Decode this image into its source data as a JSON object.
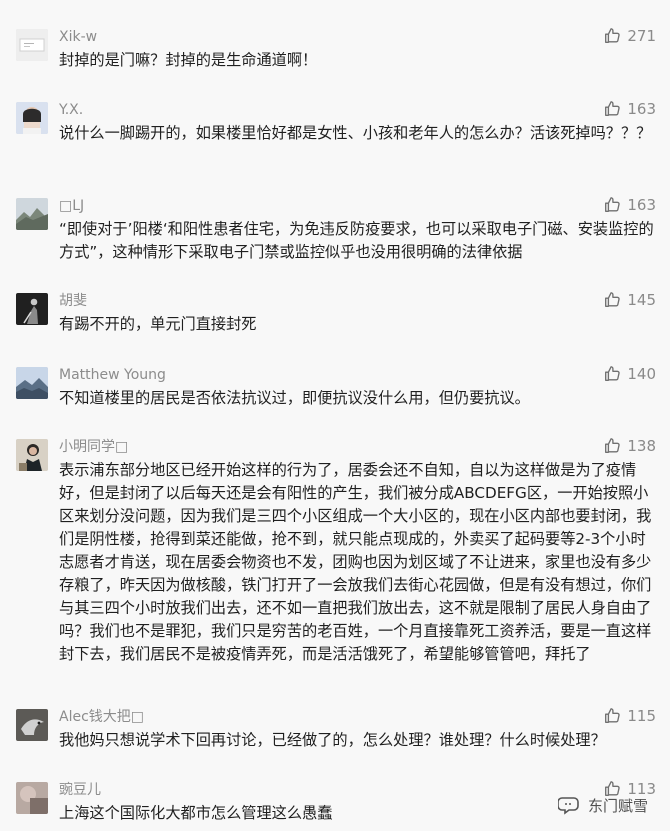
{
  "comments": [
    {
      "user": "Xik-w",
      "likes": "271",
      "text": "封掉的是门嘛？封掉的是生命通道啊！",
      "avatar": "white-card-icon"
    },
    {
      "user": "Y.X.",
      "likes": "163",
      "text": "说什么一脚踢开的，如果楼里恰好都是女性、小孩和老年人的怎么办？活该死掉吗？？？",
      "avatar": "girl-avatar-icon"
    },
    {
      "user": "□LJ",
      "likes": "163",
      "text": "“即使对于’阳楼‘和阳性患者住宅，为免违反防疫要求，也可以采取电子门磁、安装监控的方式”，这种情形下采取电子门禁或监控似乎也没用很明确的法律依据",
      "avatar": "mountain-avatar-icon"
    },
    {
      "user": "胡斐",
      "likes": "145",
      "text": "有踢不开的，单元门直接封死",
      "avatar": "dark-figure-avatar-icon"
    },
    {
      "user": "Matthew Young",
      "likes": "140",
      "text": "不知道楼里的居民是否依法抗议过，即便抗议没什么用，但仍要抗议。",
      "avatar": "landscape-avatar-icon"
    },
    {
      "user": "小明同学□",
      "likes": "138",
      "text": "表示浦东部分地区已经开始这样的行为了，居委会还不自知，自以为这样做是为了疫情好，但是封闭了以后每天还是会有阳性的产生，我们被分成ABCDEFG区，一开始按照小区来划分没问题，因为我们是三四个小区组成一个大小区的，现在小区内部也要封闭，我们是阴性楼，抢得到菜还能做，抢不到，就只能点现成的，外卖买了起码要等2-3个小时志愿者才肯送，现在居委会物资也不发，团购也因为划区域了不让进来，家里也没有多少存粮了，昨天因为做核酸，铁门打开了一会放我们去街心花园做，但是有没有想过，你们与其三四个小时放我们出去，还不如一直把我们放出去，这不就是限制了居民人身自由了吗？我们也不是罪犯，我们只是穷苦的老百姓，一个月直接靠死工资养活，要是一直这样封下去，我们居民不是被疫情弄死，而是活活饿死了，希望能够管管吧，拜托了",
      "avatar": "person-avatar-icon"
    },
    {
      "user": "Alec钱大把□",
      "likes": "115",
      "text": "我他妈只想说学术下回再讨论，已经做了的，怎么处理？谁处理？什么时候处理？",
      "avatar": "bird-avatar-icon"
    },
    {
      "user": "豌豆儿",
      "likes": "113",
      "text": "上海这个国际化大都市怎么管理这么愚蠢",
      "avatar": "blurred-avatar-icon"
    }
  ],
  "watermark": "东门赋雪",
  "colors": {
    "background": "#f8f8f8",
    "text": "#1f1f1f",
    "meta": "#8c8c8c"
  }
}
